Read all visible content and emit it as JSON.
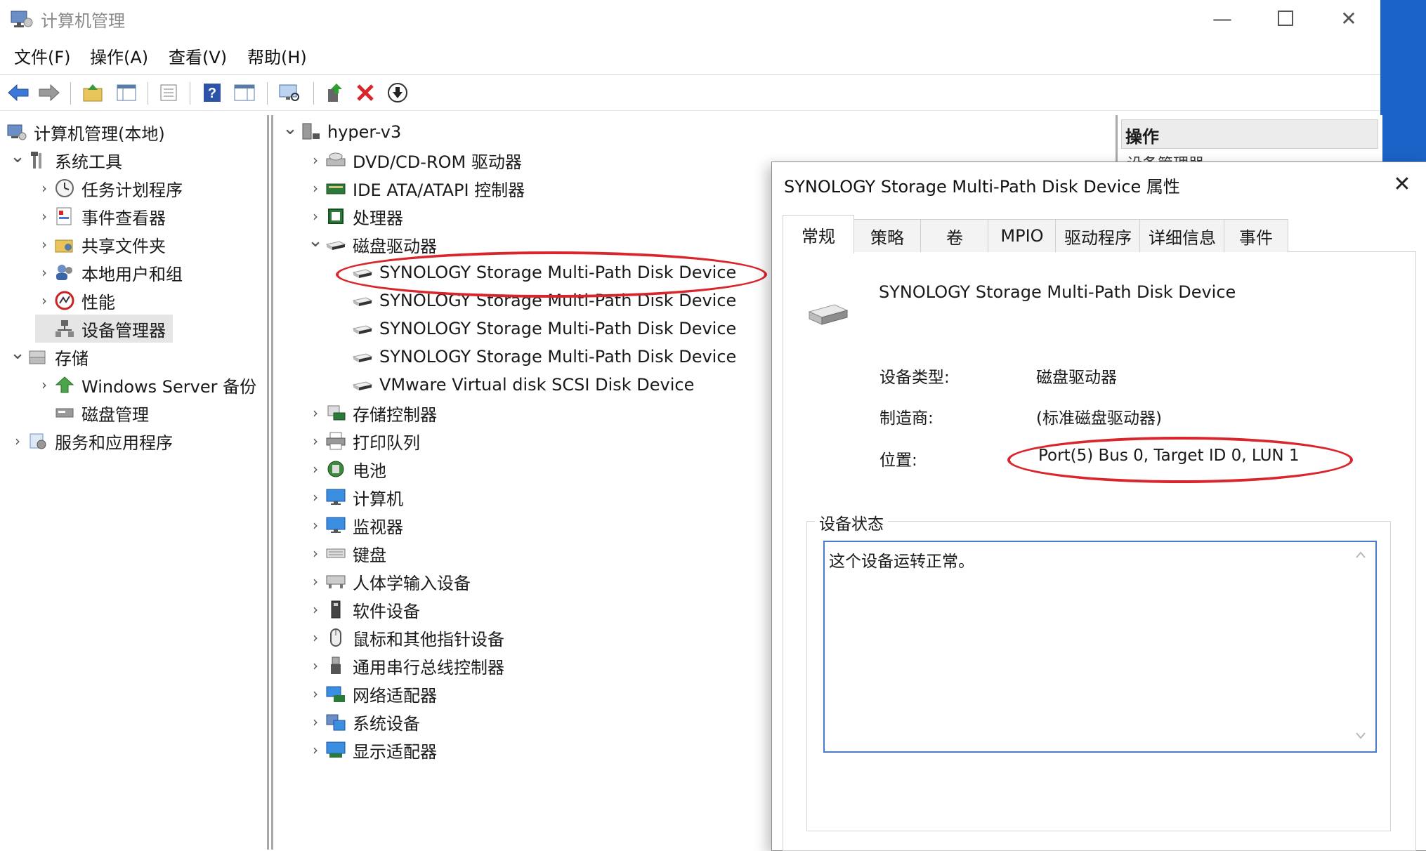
{
  "window": {
    "title": "计算机管理"
  },
  "menubar": [
    "文件(F)",
    "操作(A)",
    "查看(V)",
    "帮助(H)"
  ],
  "left_tree": {
    "items": [
      {
        "label": "计算机管理(本地)",
        "icon": "computer-management-icon"
      },
      {
        "label": "系统工具",
        "icon": "tools-icon"
      },
      {
        "label": "任务计划程序",
        "icon": "clock-icon"
      },
      {
        "label": "事件查看器",
        "icon": "event-viewer-icon"
      },
      {
        "label": "共享文件夹",
        "icon": "shared-folder-icon"
      },
      {
        "label": "本地用户和组",
        "icon": "users-icon"
      },
      {
        "label": "性能",
        "icon": "performance-icon"
      },
      {
        "label": "设备管理器",
        "icon": "device-manager-icon"
      },
      {
        "label": "存储",
        "icon": "storage-icon"
      },
      {
        "label": "Windows Server 备份",
        "icon": "backup-icon"
      },
      {
        "label": "磁盘管理",
        "icon": "disk-management-icon"
      },
      {
        "label": "服务和应用程序",
        "icon": "services-icon"
      }
    ]
  },
  "device_tree": {
    "root": "hyper-v3",
    "items": [
      "DVD/CD-ROM 驱动器",
      "IDE ATA/ATAPI 控制器",
      "处理器",
      "磁盘驱动器",
      "SYNOLOGY Storage  Multi-Path Disk Device",
      "SYNOLOGY Storage  Multi-Path Disk Device",
      "SYNOLOGY Storage  Multi-Path Disk Device",
      "SYNOLOGY Storage  Multi-Path Disk Device",
      "VMware Virtual disk SCSI Disk Device",
      "存储控制器",
      "打印队列",
      "电池",
      "计算机",
      "监视器",
      "键盘",
      "人体学输入设备",
      "软件设备",
      "鼠标和其他指针设备",
      "通用串行总线控制器",
      "网络适配器",
      "系统设备",
      "显示适配器"
    ]
  },
  "actions": {
    "title": "操作",
    "sub": "设备管理器"
  },
  "dialog": {
    "title": "SYNOLOGY Storage  Multi-Path Disk Device 属性",
    "tabs": [
      "常规",
      "策略",
      "卷",
      "MPIO",
      "驱动程序",
      "详细信息",
      "事件"
    ],
    "device_name": "SYNOLOGY Storage  Multi-Path Disk Device",
    "props": {
      "type_label": "设备类型:",
      "type_value": "磁盘驱动器",
      "mfr_label": "制造商:",
      "mfr_value": "(标准磁盘驱动器)",
      "loc_label": "位置:",
      "loc_value": "Port(5) Bus 0, Target ID 0, LUN 1"
    },
    "status_legend": "设备状态",
    "status_text": "这个设备运转正常。"
  },
  "colors": {
    "highlight": "#d9262c",
    "accent": "#4a7bd1",
    "taskbar": "#1b63c6"
  }
}
